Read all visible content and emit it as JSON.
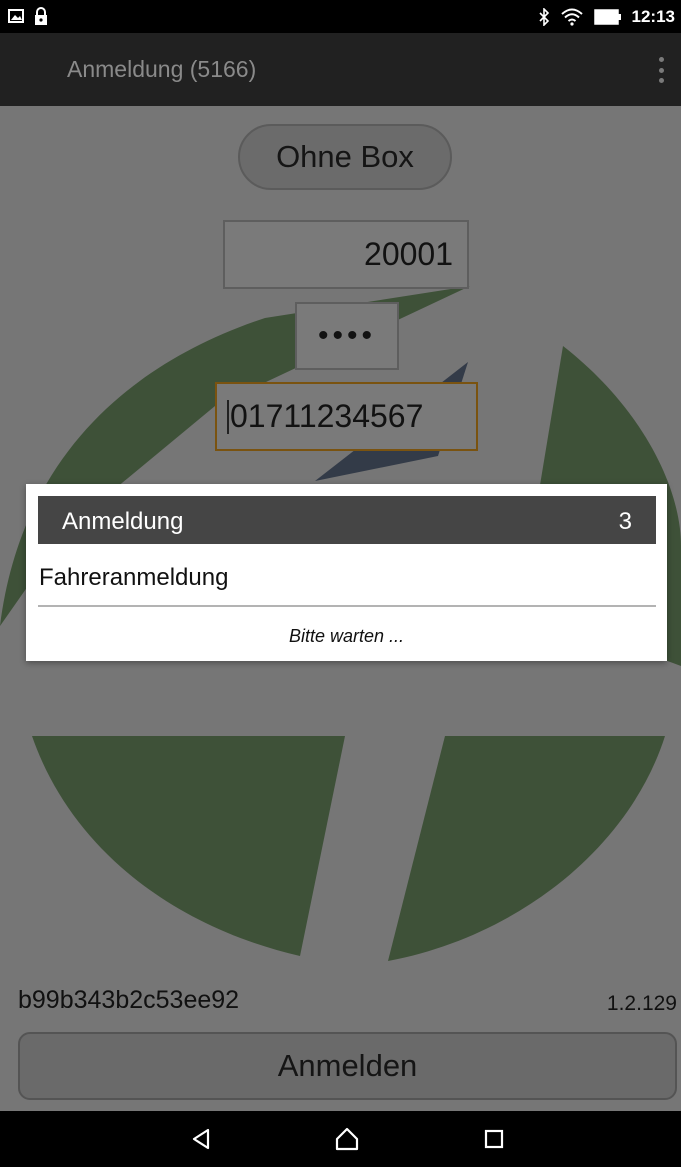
{
  "status_bar": {
    "time": "12:13",
    "icons_left": [
      "image-notification-icon",
      "lock-icon"
    ],
    "icons_right": [
      "bluetooth-icon",
      "wifi-icon",
      "battery-icon"
    ]
  },
  "app_bar": {
    "title": "Anmeldung (5166)",
    "overflow_icon": "more-vertical-icon"
  },
  "form": {
    "ohne_box_label": "Ohne Box",
    "user_value": "20001",
    "pin_value": "••••",
    "phone_value": "01711234567"
  },
  "dialog": {
    "title": "Anmeldung",
    "count": "3",
    "message": "Fahreranmeldung",
    "wait_text": "Bitte warten ..."
  },
  "footer": {
    "device_id": "b99b343b2c53ee92",
    "version": "1.2.129",
    "login_label": "Anmelden"
  },
  "nav_bar": {
    "icons": [
      "back-icon",
      "home-icon",
      "recents-icon"
    ]
  },
  "colors": {
    "logo_green": "#3e5138",
    "logo_navy": "#333b48",
    "dim_background": "#767676",
    "dialog_header": "#454545",
    "focus_border": "#7a5310"
  }
}
